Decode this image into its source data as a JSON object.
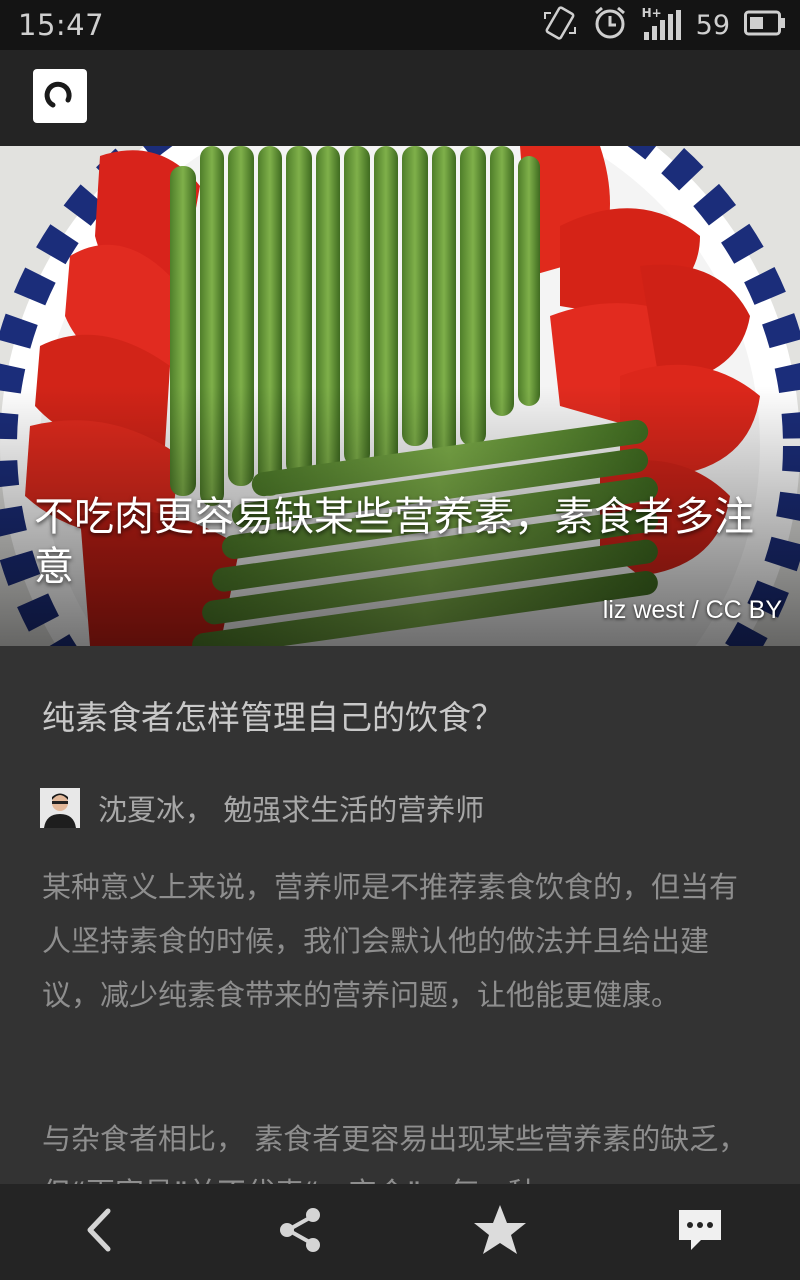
{
  "status_bar": {
    "time": "15:47",
    "network": "H+",
    "battery": "59",
    "icons": [
      "screen-rotate-icon",
      "alarm-icon",
      "signal-icon",
      "battery-icon"
    ]
  },
  "app": {
    "logo_icon": "app-logo-icon"
  },
  "hero": {
    "title": "不吃肉更容易缺某些营养素，素食者多注意",
    "credit": "liz west / CC BY"
  },
  "article": {
    "question": "纯素食者怎样管理自己的饮食？",
    "author": "沈夏冰， 勉强求生活的营养师",
    "paragraphs": [
      "某种意义上来说，营养师是不推荐素食饮食的，但当有人坚持素食的时候，我们会默认他的做法并且给出建议，减少纯素食带来的营养问题，让他能更健康。",
      "与杂食者相比， 素食者更容易出现某些营养素的缺乏，但“更容易”并不代表“一定会”。每一种"
    ]
  },
  "bottom_bar": {
    "buttons": [
      "back-icon",
      "share-icon",
      "star-icon",
      "comment-icon"
    ]
  },
  "colors": {
    "background": "#333333",
    "bar": "#242424",
    "status": "#141414"
  }
}
